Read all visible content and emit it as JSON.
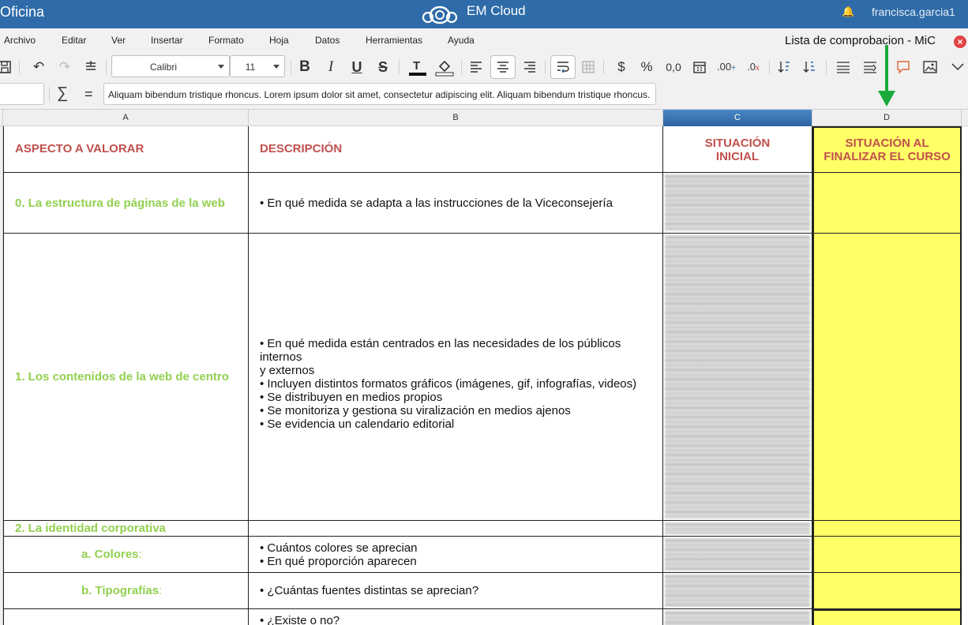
{
  "header": {
    "app_name": "Oficina",
    "cloud_name": "EM Cloud",
    "user": "francisca.garcia1",
    "bell_icon": "bell-icon"
  },
  "menu": {
    "items": [
      "Archivo",
      "Editar",
      "Ver",
      "Insertar",
      "Formato",
      "Hoja",
      "Datos",
      "Herramientas",
      "Ayuda"
    ],
    "document_title": "Lista de comprobacion - MiC"
  },
  "toolbar": {
    "font_name": "Calibri",
    "font_size": "11",
    "bold": "B",
    "italic": "I",
    "underline": "U",
    "strike": "S",
    "currency": "$",
    "percent": "%",
    "decimals": "0,0",
    "add_decimal": ".00",
    "remove_decimal": ".0"
  },
  "formula": {
    "namebox": "",
    "sigma": "∑",
    "equals": "=",
    "content": "Aliquam bibendum tristique rhoncus. Lorem ipsum dolor sit amet, consectetur adipiscing elit. Aliquam bibendum tristique rhoncus."
  },
  "columns": [
    "A",
    "B",
    "C",
    "D"
  ],
  "sheet": {
    "headers": {
      "a": "ASPECTO A VALORAR",
      "b": "DESCRIPCIÓN",
      "c1": "SITUACIÓN",
      "c2": "INICIAL",
      "d1": "SITUACIÓN AL",
      "d2": "FINALIZAR EL CURSO"
    },
    "rows": [
      {
        "aspect": "0. La estructura de páginas de la web",
        "desc": [
          "• En qué medida se adapta a las instrucciones de la Viceconsejería"
        ]
      },
      {
        "aspect": "1. Los contenidos de la web de centro",
        "desc": [
          "• En qué medida están centrados en las necesidades de los públicos internos",
          "y externos",
          "• Incluyen distintos formatos gráficos (imágenes, gif, infografías, videos)",
          "• Se distribuyen en medios propios",
          "• Se monitoriza y gestiona su viralización en medios ajenos",
          "• Se evidencia un calendario editorial"
        ]
      },
      {
        "aspect": "2. La identidad corporativa",
        "desc": []
      },
      {
        "aspect": "a. Colores",
        "suffix": ":",
        "desc": [
          "• Cuántos colores se aprecian",
          "• En qué proporción aparecen"
        ]
      },
      {
        "aspect": "b. Tipografías",
        "suffix": ":",
        "desc": [
          "• ¿Cuántas fuentes distintas se aprecian?"
        ]
      },
      {
        "aspect": "",
        "desc": [
          "• ¿Existe o no?"
        ]
      }
    ]
  },
  "colors": {
    "header_bar": "#2e6ba8",
    "header_text": "#c0504d",
    "aspect_text": "#92d050",
    "highlight_column": "#ffff66",
    "arrow": "#1aaa3a"
  }
}
